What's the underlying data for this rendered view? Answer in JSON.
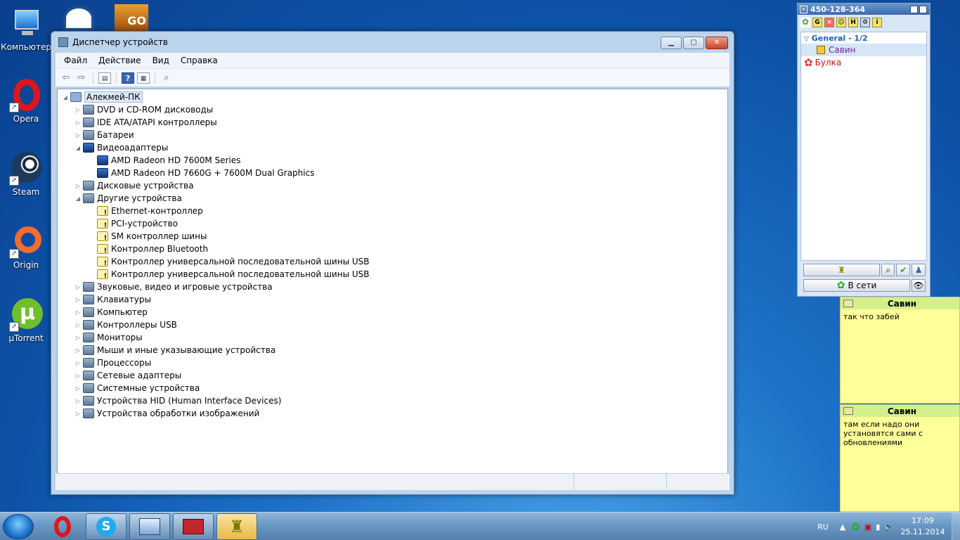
{
  "desktop": {
    "icons": [
      {
        "label": "Компьютер",
        "icon": "computer-icon"
      },
      {
        "label": "Opera",
        "icon": "opera-icon"
      },
      {
        "label": "Steam",
        "icon": "steam-icon"
      },
      {
        "label": "Origin",
        "icon": "origin-icon"
      },
      {
        "label": "µTorrent",
        "icon": "utorrent-icon"
      }
    ],
    "top_icons": [
      {
        "icon": "network-app-icon"
      },
      {
        "icon": "csgo-icon",
        "text": "GO"
      }
    ]
  },
  "window": {
    "title": "Диспетчер устройств",
    "buttons": {
      "minimize": "▁",
      "maximize": "▢",
      "close": "✕"
    },
    "menu": [
      "Файл",
      "Действие",
      "Вид",
      "Справка"
    ],
    "toolbar": [
      "back-icon",
      "forward-icon",
      "properties-icon",
      "help-icon",
      "update-driver-icon",
      "scan-hardware-icon"
    ],
    "tree": {
      "root": "Алекмей-ПК",
      "items": [
        {
          "label": "DVD и CD-ROM дисководы",
          "level": 1,
          "expanded": false,
          "icon": "dvd-drive-icon"
        },
        {
          "label": "IDE ATA/ATAPI контроллеры",
          "level": 1,
          "expanded": false,
          "icon": "ide-controller-icon"
        },
        {
          "label": "Батареи",
          "level": 1,
          "expanded": false,
          "icon": "battery-icon"
        },
        {
          "label": "Видеоадаптеры",
          "level": 1,
          "expanded": true,
          "icon": "display-adapter-icon"
        },
        {
          "label": "AMD Radeon HD 7600M Series",
          "level": 2,
          "icon": "display-adapter-icon"
        },
        {
          "label": "AMD Radeon HD 7660G + 7600M Dual Graphics",
          "level": 2,
          "icon": "display-adapter-icon"
        },
        {
          "label": "Дисковые устройства",
          "level": 1,
          "expanded": false,
          "icon": "disk-drive-icon"
        },
        {
          "label": "Другие устройства",
          "level": 1,
          "expanded": true,
          "icon": "unknown-device-icon"
        },
        {
          "label": "Ethernet-контроллер",
          "level": 2,
          "icon": "warning-device-icon"
        },
        {
          "label": "PCI-устройство",
          "level": 2,
          "icon": "warning-device-icon"
        },
        {
          "label": "SM контроллер шины",
          "level": 2,
          "icon": "warning-device-icon"
        },
        {
          "label": "Контроллер Bluetooth",
          "level": 2,
          "icon": "warning-device-icon"
        },
        {
          "label": "Контроллер универсальной последовательной шины USB",
          "level": 2,
          "icon": "warning-device-icon"
        },
        {
          "label": "Контроллер универсальной последовательной шины USB",
          "level": 2,
          "icon": "warning-device-icon"
        },
        {
          "label": "Звуковые, видео и игровые устройства",
          "level": 1,
          "expanded": false,
          "icon": "speaker-icon"
        },
        {
          "label": "Клавиатуры",
          "level": 1,
          "expanded": false,
          "icon": "keyboard-icon"
        },
        {
          "label": "Компьютер",
          "level": 1,
          "expanded": false,
          "icon": "computer-icon"
        },
        {
          "label": "Контроллеры USB",
          "level": 1,
          "expanded": false,
          "icon": "usb-icon"
        },
        {
          "label": "Мониторы",
          "level": 1,
          "expanded": false,
          "icon": "monitor-icon"
        },
        {
          "label": "Мыши и иные указывающие устройства",
          "level": 1,
          "expanded": false,
          "icon": "mouse-icon"
        },
        {
          "label": "Процессоры",
          "level": 1,
          "expanded": false,
          "icon": "cpu-icon"
        },
        {
          "label": "Сетевые адаптеры",
          "level": 1,
          "expanded": false,
          "icon": "network-adapter-icon"
        },
        {
          "label": "Системные устройства",
          "level": 1,
          "expanded": false,
          "icon": "system-device-icon"
        },
        {
          "label": "Устройства HID (Human Interface Devices)",
          "level": 1,
          "expanded": false,
          "icon": "hid-icon"
        },
        {
          "label": "Устройства обработки изображений",
          "level": 1,
          "expanded": false,
          "icon": "imaging-device-icon"
        }
      ]
    }
  },
  "messenger": {
    "uin": "450-128-364",
    "toolbar_letters": [
      "",
      "G",
      "",
      "",
      "H",
      "",
      "i"
    ],
    "group": "General - 1/2",
    "contacts": [
      {
        "name": "Савин",
        "color": "#7a1fa0",
        "icon": "online-status-icon"
      },
      {
        "name": "Булка",
        "color": "#d01010",
        "icon": "offline-flower-icon"
      }
    ],
    "status_button": "В сети"
  },
  "notes": [
    {
      "sender": "Савин",
      "text": "так что забей"
    },
    {
      "sender": "Савин",
      "text": "там если надо они установятся сами с обновлениями"
    }
  ],
  "taskbar": {
    "language": "RU",
    "time": "17:09",
    "date": "25.11.2014"
  },
  "colors": {
    "selection": "#dfe9f7",
    "note_bg": "#ffff99",
    "note_header": "#d3f08c"
  }
}
